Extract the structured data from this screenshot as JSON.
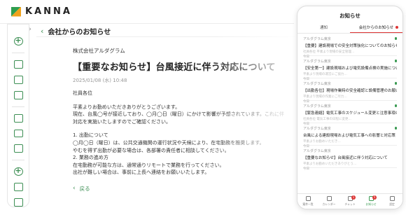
{
  "app": {
    "logo": "KANNA",
    "brand_color": "#3d8f54",
    "accent_color": "#f0a21b"
  },
  "sidebar": {
    "icons": [
      "add-icon",
      "list-icon",
      "grid-icon",
      "board-icon",
      "document-icon",
      "files-icon",
      "clipboard-icon",
      "settings-icon",
      "users-icon",
      "building-icon"
    ]
  },
  "header": {
    "title": "会社からのお知らせ"
  },
  "notice": {
    "company": "株式会社アルダグラム",
    "title": "【重要なお知らせ】台風接近に伴う対応について",
    "timestamp": "2025/01/08 (水) 10:48",
    "lines": [
      "社員各位",
      "",
      "平素よりお勤めいただきありがとうございます。",
      "現在、台風◯号が接近しており、◯月◯日（曜日）にかけて影響が予想されています。これに伴",
      "対応を実施いたしますのでご確認ください。",
      "",
      "1. 出勤について",
      "◯月◯日（曜日）は、公共交通機関の運行状況や天候により、在宅勤務を推奨します。",
      "やむを得ず出勤が必要な場合は、各部署の責任者に相談してください。",
      "2. 業務の進め方",
      "在宅勤務が可能な方は、通常通りリモートで業務を行ってください。",
      "出社が難しい場合は、事前に上長へ連絡をお願いいたします。"
    ],
    "back_label": "戻る"
  },
  "phone": {
    "title": "お知らせ",
    "tabs": [
      "通知",
      "会社からのお知らせ"
    ],
    "active_tab": 1,
    "items": [
      {
        "sender": "アルダグラム東京",
        "subject": "【重要】建設現場での安全対策強化についてのお知らせ",
        "preview": "社員各位 平素より現場の安全管理…",
        "time": "今日",
        "unread": true
      },
      {
        "sender": "アルダグラム東京",
        "subject": "【安全第一】建設現場および電気設備点検の実施について",
        "preview": "平素より現場の運営にご協力…",
        "time": "今日",
        "unread": true
      },
      {
        "sender": "アルダグラム東京",
        "subject": "【出勤各位】現場作業時の安全確認と設備管理のお願い",
        "preview": "平素より現場の作業にご尽力…",
        "time": "今日",
        "unread": true
      },
      {
        "sender": "アルダグラム東京",
        "subject": "【緊急連絡】電気工事のスケジュール変更と注意事項のお知らせ",
        "preview": "社員各位 電気工事の日程に変更…",
        "time": "今日",
        "unread": true
      },
      {
        "sender": "アルダグラム東京",
        "subject": "台風による建設現場および電気工事への影響と対応策",
        "preview": "平素よりお勤めいただき…",
        "time": "今日",
        "unread": true
      },
      {
        "sender": "アルダグラム東京",
        "subject": "【重要なお知らせ】台風接近に伴う対応について",
        "preview": "平素よりお勤めいただきありがとう…",
        "time": "今日",
        "unread": false
      }
    ],
    "nav": [
      {
        "label": "案件一覧",
        "icon": "home-icon"
      },
      {
        "label": "カレンダー",
        "icon": "calendar-icon"
      },
      {
        "label": "チャット",
        "icon": "chat-icon",
        "badge": "1"
      },
      {
        "label": "お知らせ",
        "icon": "bell-icon",
        "badge": "5",
        "active": true
      },
      {
        "label": "設定",
        "icon": "settings-icon"
      }
    ]
  }
}
